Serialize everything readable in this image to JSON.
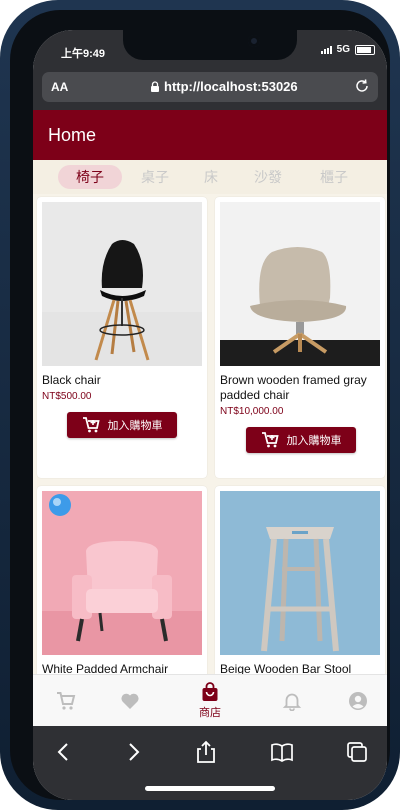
{
  "status": {
    "time": "上午9:49",
    "network": "5G"
  },
  "browser": {
    "text_size": "AA",
    "url": "http://localhost:53026"
  },
  "appbar": {
    "title": "Home"
  },
  "tabs": [
    {
      "label": "椅子",
      "active": true
    },
    {
      "label": "桌子",
      "active": false
    },
    {
      "label": "床",
      "active": false
    },
    {
      "label": "沙發",
      "active": false
    },
    {
      "label": "櫃子",
      "active": false
    }
  ],
  "products": [
    {
      "name": "Black chair",
      "price": "NT$500.00",
      "button": "加入購物車",
      "icon": "black-eames-chair-photo"
    },
    {
      "name": "Brown wooden framed gray padded chair",
      "price": "NT$10,000.00",
      "button": "加入購物車",
      "icon": "gray-lounge-chair-photo"
    },
    {
      "name": "White Padded Armchair",
      "icon": "pink-armchair-photo"
    },
    {
      "name": "Beige Wooden Bar Stool",
      "icon": "wooden-stool-photo"
    }
  ],
  "nav": [
    {
      "icon": "cart-icon",
      "label": ""
    },
    {
      "icon": "heart-icon",
      "label": ""
    },
    {
      "icon": "shop-bag-icon",
      "label": "商店"
    },
    {
      "icon": "bell-icon",
      "label": ""
    },
    {
      "icon": "account-icon",
      "label": ""
    }
  ],
  "colors": {
    "primary": "#7d0018",
    "tab_active_bg": "#f1d4d7",
    "background": "#f7f3e9",
    "browser_chrome": "#2f3034"
  }
}
